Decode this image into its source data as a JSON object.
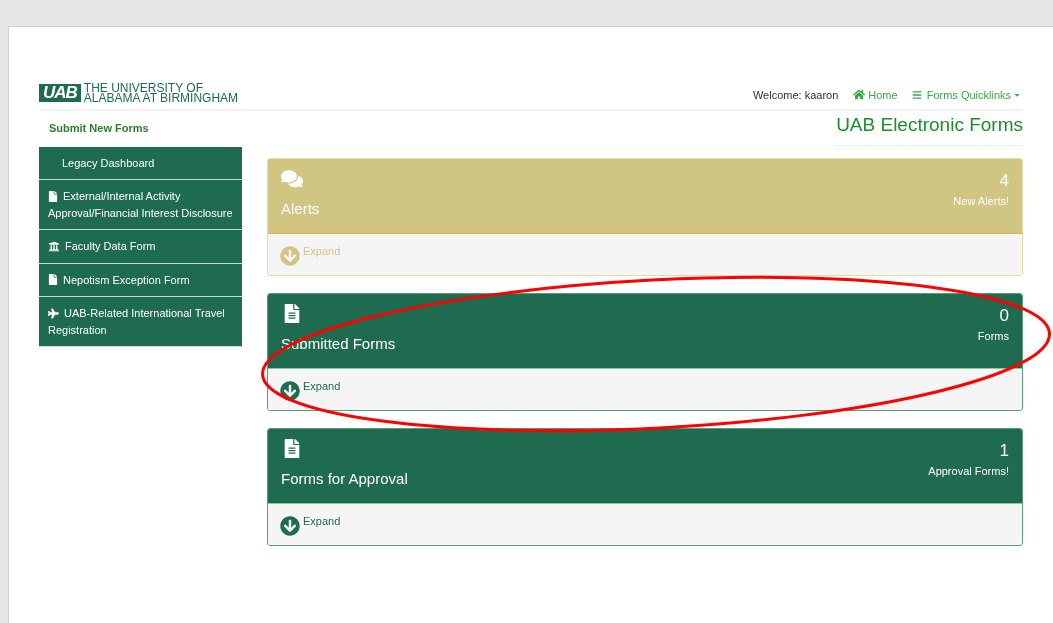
{
  "header": {
    "logo_mark": "UAB",
    "logo_text": [
      "THE UNIVERSITY OF",
      "ALABAMA AT BIRMINGHAM"
    ],
    "welcome": "Welcome: kaaron",
    "nav": [
      {
        "label": "Home",
        "kind": "home"
      },
      {
        "label": "Forms Quicklinks",
        "kind": "menu"
      }
    ]
  },
  "sidebar": {
    "title": "Submit New Forms",
    "items": [
      {
        "label": "Legacy Dashboard",
        "kind": "plain"
      },
      {
        "label": "External/Internal Activity Approval/Financial Interest Disclosure",
        "kind": "file"
      },
      {
        "label": "Faculty Data Form",
        "kind": "bank"
      },
      {
        "label": "Nepotism Exception Form",
        "kind": "file"
      },
      {
        "label": "UAB-Related International Travel Registration",
        "kind": "plane"
      }
    ]
  },
  "page_title": "UAB Electronic Forms",
  "panels": [
    {
      "kind": "alerts",
      "title": "Alerts",
      "count": "4",
      "count_label": "New Alerts!",
      "action": "Expand"
    },
    {
      "kind": "forms",
      "title": "Submitted Forms",
      "count": "0",
      "count_label": "Forms",
      "action": "Expand"
    },
    {
      "kind": "forms",
      "title": "Forms for Approval",
      "count": "1",
      "count_label": "Approval Forms!",
      "action": "Expand"
    }
  ],
  "annotation": {
    "kind": "ellipse"
  }
}
